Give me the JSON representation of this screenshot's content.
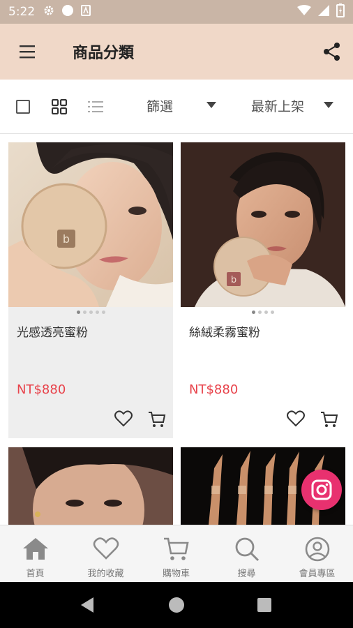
{
  "status_bar": {
    "time": "5:22"
  },
  "app_bar": {
    "title": "商品分類",
    "menu_icon": "hamburger-menu-icon",
    "share_icon": "share-icon"
  },
  "toolbar": {
    "filter_label": "篩選",
    "sort_label": "最新上架"
  },
  "products": [
    {
      "name": "光感透亮蜜粉",
      "price": "NT$880"
    },
    {
      "name": "絲絨柔霧蜜粉",
      "price": "NT$880"
    }
  ],
  "bottom_nav": [
    {
      "label": "首頁",
      "icon": "home-icon"
    },
    {
      "label": "我的收藏",
      "icon": "heart-icon"
    },
    {
      "label": "購物車",
      "icon": "cart-icon"
    },
    {
      "label": "搜尋",
      "icon": "search-icon"
    },
    {
      "label": "會員專區",
      "icon": "user-icon"
    }
  ],
  "colors": {
    "status_bar": "#c9b5a6",
    "app_bar": "#f0d8c8",
    "price": "#e8434b",
    "fab": "#e8316f"
  }
}
